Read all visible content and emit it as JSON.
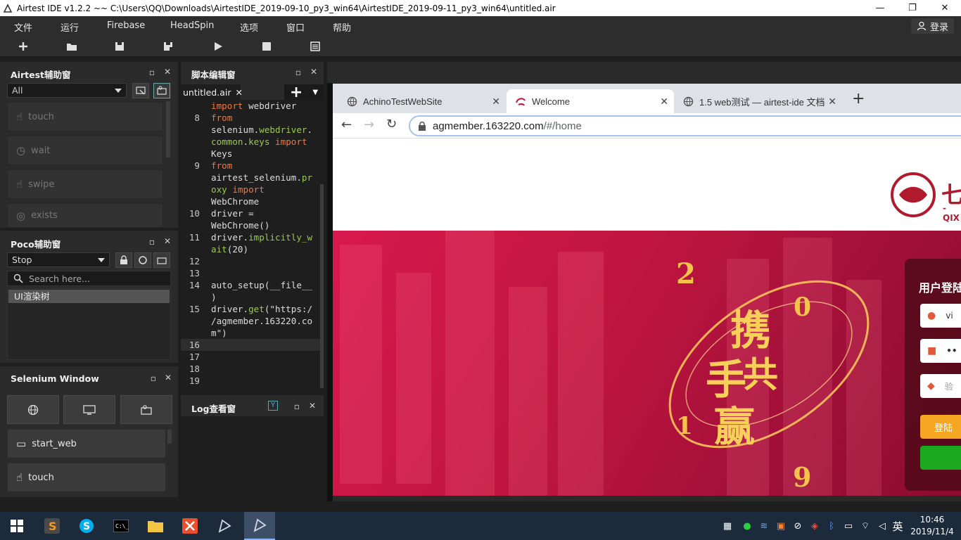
{
  "window": {
    "title": "Airtest IDE v1.2.2 ~~ C:\\Users\\QQ\\Downloads\\AirtestIDE_2019-09-10_py3_win64\\AirtestIDE_2019-09-11_py3_win64\\untitled.air",
    "minimize": "—",
    "restore": "❐",
    "close": "✕"
  },
  "menu": {
    "items": [
      "文件",
      "运行",
      "Firebase",
      "HeadSpin",
      "选项",
      "窗口",
      "帮助"
    ],
    "login": "登录"
  },
  "toolbar": {
    "buttons": [
      "new-icon",
      "open-folder-icon",
      "save-icon",
      "save-as-icon",
      "run-icon",
      "stop-icon",
      "log-icon"
    ]
  },
  "airtest_panel": {
    "title": "Airtest辅助窗",
    "filter": "All",
    "actions": [
      "touch",
      "wait",
      "swipe",
      "exists"
    ]
  },
  "poco_panel": {
    "title": "Poco辅助窗",
    "mode": "Stop",
    "search_placeholder": "Search here...",
    "tree_root": "UI渲染树"
  },
  "selenium_panel": {
    "title": "Selenium Window",
    "actions": [
      "start_web",
      "touch"
    ]
  },
  "script_panel": {
    "title": "脚本编辑窗",
    "file_tab": "untitled.air",
    "file_tab_close": "✕",
    "add": "+"
  },
  "code_lines": [
    {
      "ln": "",
      "parts": [
        [
          "kw",
          "import"
        ],
        [
          "t",
          " webdriver"
        ]
      ]
    },
    {
      "ln": "8",
      "parts": [
        [
          "kw",
          "from"
        ]
      ]
    },
    {
      "ln": "",
      "parts": [
        [
          "t",
          "selenium."
        ],
        [
          "fn",
          "webdriver"
        ],
        [
          "t",
          "."
        ]
      ]
    },
    {
      "ln": "",
      "parts": [
        [
          "fn",
          "common"
        ],
        [
          "t",
          "."
        ],
        [
          "fn",
          "keys"
        ],
        [
          "t",
          " "
        ],
        [
          "kw",
          "import"
        ]
      ]
    },
    {
      "ln": "",
      "parts": [
        [
          "t",
          "Keys"
        ]
      ]
    },
    {
      "ln": "9",
      "parts": [
        [
          "kw",
          "from"
        ]
      ]
    },
    {
      "ln": "",
      "parts": [
        [
          "t",
          "airtest_selenium."
        ],
        [
          "fn",
          "pr"
        ]
      ]
    },
    {
      "ln": "",
      "parts": [
        [
          "fn",
          "oxy"
        ],
        [
          "t",
          " "
        ],
        [
          "kw",
          "import"
        ]
      ]
    },
    {
      "ln": "",
      "parts": [
        [
          "t",
          "WebChrome"
        ]
      ]
    },
    {
      "ln": "10",
      "parts": [
        [
          "t",
          "driver ="
        ]
      ]
    },
    {
      "ln": "",
      "parts": [
        [
          "t",
          "WebChrome()"
        ]
      ]
    },
    {
      "ln": "11",
      "parts": [
        [
          "t",
          "driver."
        ],
        [
          "fn",
          "implicitly_w"
        ]
      ]
    },
    {
      "ln": "",
      "parts": [
        [
          "fn",
          "ait"
        ],
        [
          "t",
          "(20)"
        ]
      ]
    },
    {
      "ln": "12",
      "parts": []
    },
    {
      "ln": "13",
      "parts": []
    },
    {
      "ln": "14",
      "parts": [
        [
          "t",
          "auto_setup(__file__"
        ]
      ]
    },
    {
      "ln": "",
      "parts": [
        [
          "t",
          ")"
        ]
      ]
    },
    {
      "ln": "15",
      "parts": [
        [
          "t",
          "driver."
        ],
        [
          "fn",
          "get"
        ],
        [
          "t",
          "(\"https:/"
        ]
      ]
    },
    {
      "ln": "",
      "parts": [
        [
          "t",
          "/agmember.163220.co"
        ]
      ]
    },
    {
      "ln": "",
      "parts": [
        [
          "t",
          "m\")"
        ]
      ]
    },
    {
      "ln": "16",
      "parts": []
    },
    {
      "ln": "17",
      "parts": []
    },
    {
      "ln": "18",
      "parts": []
    },
    {
      "ln": "19",
      "parts": []
    }
  ],
  "log_panel": {
    "title": "Log查看窗"
  },
  "browser": {
    "tabs": [
      {
        "label": "AchinoTestWebSite"
      },
      {
        "label": "Welcome"
      },
      {
        "label": "1.5 web测试 — airtest-ide 文档"
      }
    ],
    "new_tab": "+",
    "url_host": "agmember.163220.com",
    "url_path": "/#/home",
    "page": {
      "logo_text": "七",
      "logo_sub": "-QIX",
      "login_title": "用户登陆",
      "username_fragment": "vi",
      "password_fragment": "••",
      "captcha_fragment": "验",
      "login_button": "登陆",
      "hero_digits": [
        "2",
        "0",
        "1",
        "9"
      ],
      "hero_chars": [
        "携",
        "手",
        "共",
        "赢"
      ]
    }
  },
  "taskbar": {
    "time": "10:46",
    "date": "2019/11/4",
    "ime": "英"
  },
  "colors": {
    "panel_bg": "#2b2b2b",
    "editor_bg": "#1e1e1e",
    "keyword": "#f07840",
    "function": "#9ac94a",
    "hero_red": "#d8184e",
    "login_orange": "#f5a623",
    "login_green": "#19a81e"
  }
}
